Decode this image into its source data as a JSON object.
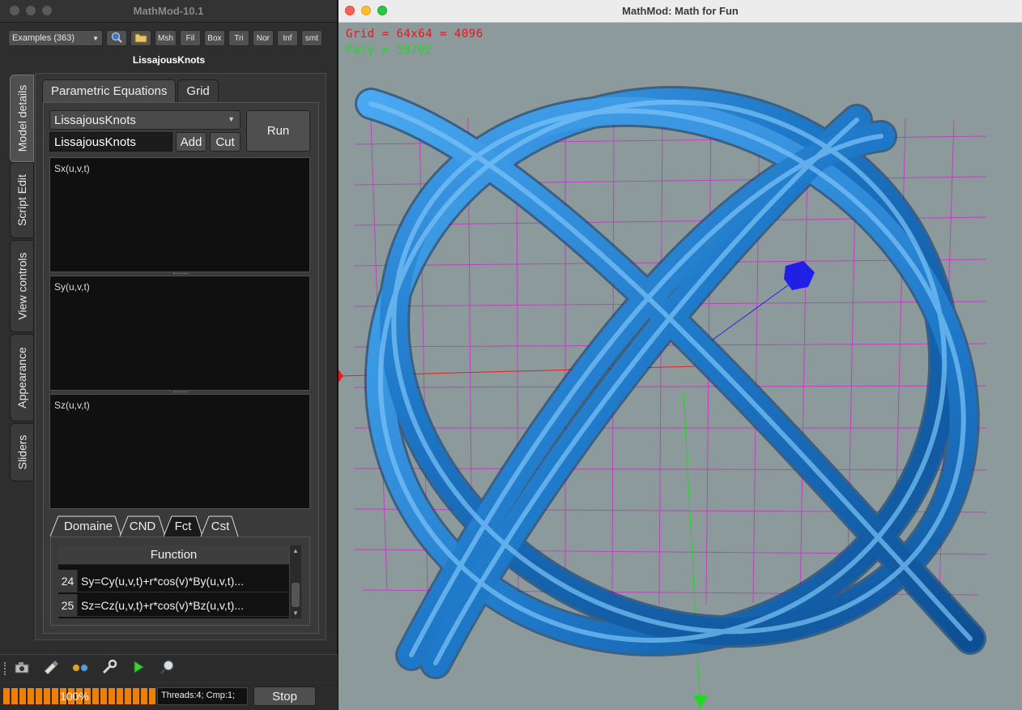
{
  "left_window": {
    "title": "MathMod-10.1",
    "toolbar": {
      "examples_combo": "Examples (363)",
      "buttons": [
        "Msh",
        "Fil",
        "Box",
        "Tri",
        "Nor",
        "Inf",
        "smt"
      ]
    },
    "model_name": "LissajousKnots",
    "side_tabs": [
      "Model details",
      "Script Edit",
      "View controls",
      "Appearance",
      "Sliders"
    ],
    "top_tabs": [
      "Parametric Equations",
      "Grid"
    ],
    "model_select": "LissajousKnots",
    "name_field_value": "LissajousKnots",
    "add_label": "Add",
    "cut_label": "Cut",
    "run_label": "Run",
    "equations": {
      "sx_label": "Sx(u,v,t)",
      "sy_label": "Sy(u,v,t)",
      "sz_label": "Sz(u,v,t)"
    },
    "bottom_tabs": [
      "Domaine",
      "CND",
      "Fct",
      "Cst"
    ],
    "table": {
      "header": "Function",
      "rows": [
        {
          "num": "24",
          "value": "Sy=Cy(u,v,t)+r*cos(v)*By(u,v,t)..."
        },
        {
          "num": "25",
          "value": "Sz=Cz(u,v,t)+r*cos(v)*Bz(u,v,t)..."
        }
      ]
    },
    "progress_text": "100%",
    "progress_value": 1.0,
    "threads_text": "Threads:4; Cmp:1;",
    "stop_label": "Stop"
  },
  "right_window": {
    "title": "MathMod: Math for Fun",
    "hud": {
      "grid_text": "Grid = 64x64 = 4096",
      "poly_text": "Poly = 58702"
    }
  },
  "colors": {
    "progress": "#f07f0a",
    "tube": "#1e78c8",
    "grid": "#c23ac0",
    "viewport_bg": "#8d9a9c",
    "hud_grid": "#e8141e",
    "hud_poly": "#22d622"
  },
  "icons": [
    "magnifier-icon",
    "folder-icon",
    "camera-icon",
    "brush-icon",
    "glasses-icon",
    "wrench-icon",
    "play-icon",
    "search-icon"
  ]
}
